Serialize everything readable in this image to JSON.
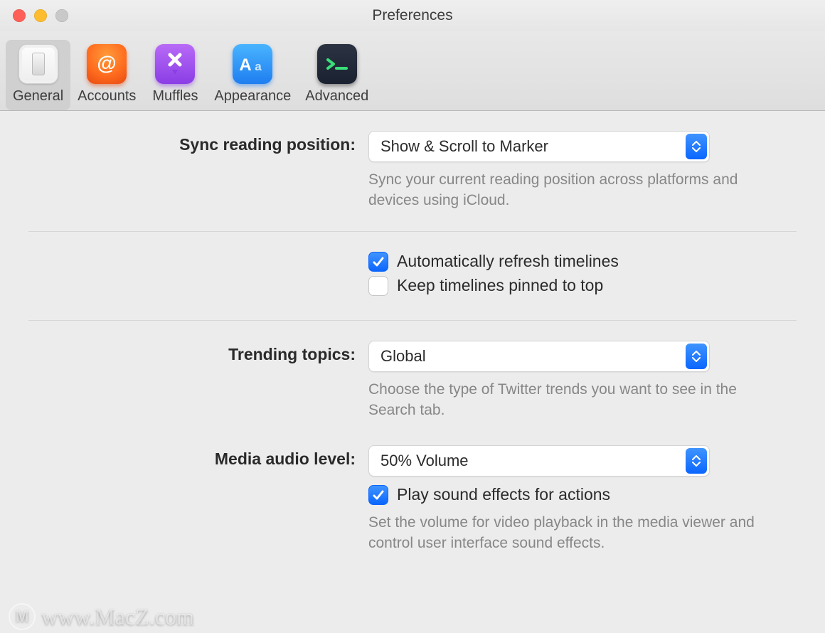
{
  "window": {
    "title": "Preferences"
  },
  "toolbar": {
    "items": [
      {
        "id": "general",
        "label": "General",
        "selected": true
      },
      {
        "id": "accounts",
        "label": "Accounts",
        "selected": false
      },
      {
        "id": "muffles",
        "label": "Muffles",
        "selected": false
      },
      {
        "id": "appearance",
        "label": "Appearance",
        "selected": false
      },
      {
        "id": "advanced",
        "label": "Advanced",
        "selected": false
      }
    ]
  },
  "general": {
    "sync_position": {
      "label": "Sync reading position:",
      "value": "Show & Scroll to Marker",
      "helper": "Sync your current reading position across platforms and devices using iCloud."
    },
    "timelines": {
      "auto_refresh": {
        "label": "Automatically refresh timelines",
        "checked": true
      },
      "pinned_top": {
        "label": "Keep timelines pinned to top",
        "checked": false
      }
    },
    "trending": {
      "label": "Trending topics:",
      "value": "Global",
      "helper": "Choose the type of Twitter trends you want to see in the Search tab."
    },
    "audio": {
      "label": "Media audio level:",
      "value": "50% Volume",
      "sound_effects": {
        "label": "Play sound effects for actions",
        "checked": true
      },
      "helper": "Set the volume for video playback in the media viewer and control user interface sound effects."
    }
  },
  "watermark": {
    "logo_letter": "M",
    "text": "www.MacZ.com"
  }
}
